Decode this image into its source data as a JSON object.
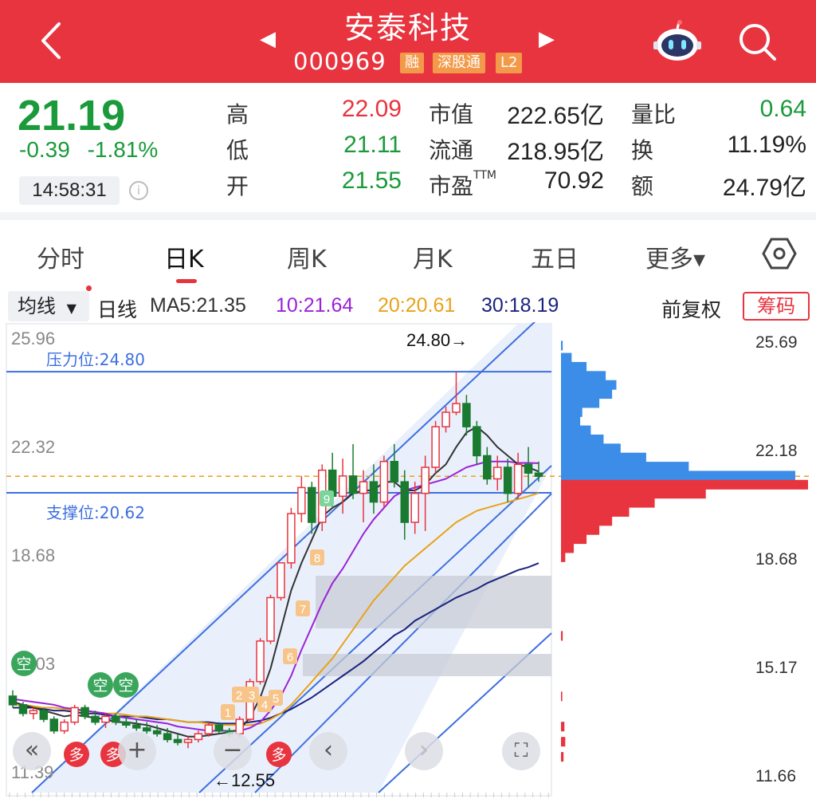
{
  "header": {
    "stock_name": "安泰科技",
    "code": "000969",
    "tags": [
      "融",
      "深股通",
      "L2"
    ],
    "colors": {
      "bar": "#e8343f",
      "tag": "#f39a4a"
    }
  },
  "quote": {
    "price": "21.19",
    "change": "-0.39",
    "change_pct": "-1.81%",
    "time": "14:58:31",
    "high_label": "高",
    "high": "22.09",
    "low_label": "低",
    "low": "21.11",
    "open_label": "开",
    "open": "21.55",
    "mktcap_label": "市值",
    "mktcap": "222.65亿",
    "float_label": "流通",
    "float": "218.95亿",
    "pe_label": "市盈",
    "pe_sup": "TTM",
    "pe": "70.92",
    "volratio_label": "量比",
    "volratio": "0.64",
    "turnover_label": "换",
    "turnover": "11.19%",
    "amount_label": "额",
    "amount": "24.79亿",
    "colors": {
      "down": "#1a9a3a",
      "up": "#e8343f"
    }
  },
  "tabs": [
    {
      "label": "分时"
    },
    {
      "label": "日K",
      "active": true
    },
    {
      "label": "周K"
    },
    {
      "label": "月K"
    },
    {
      "label": "五日"
    },
    {
      "label": "更多▾"
    }
  ],
  "ma_bar": {
    "selector": "均线",
    "line_type": "日线",
    "ma5": "MA5:21.35",
    "ma10": "10:21.64",
    "ma20": "20:20.61",
    "ma30": "30:18.19",
    "adjust": "前复权",
    "chips": "筹码",
    "colors": {
      "ma5": "#333333",
      "ma10": "#9b22d6",
      "ma20": "#e8a21a",
      "ma30": "#1a237e"
    }
  },
  "chart": {
    "y_labels": [
      "25.96",
      "22.32",
      "18.68",
      "15.03",
      "11.39"
    ],
    "pressure_label": "压力位:24.80",
    "support_label": "支撑位:20.62",
    "peak_label": "24.80→",
    "low_label": "←12.55",
    "chip_labels": [
      "25.69",
      "22.18",
      "18.68",
      "15.17",
      "11.66"
    ],
    "signals_kong": [
      "空",
      "空",
      "空"
    ],
    "signals_duo": [
      "多",
      "多",
      "多"
    ],
    "counts": [
      "1",
      "2",
      "3",
      "4",
      "5",
      "6",
      "7",
      "8",
      "9"
    ],
    "controls": {
      "back": "«",
      "zoom_in": "+",
      "zoom_out": "−",
      "prev": "‹",
      "next": "›",
      "fullscreen": "⛶"
    },
    "candles": [
      [
        13.6,
        13.8,
        13.2,
        13.3
      ],
      [
        13.3,
        13.4,
        12.9,
        13.0
      ],
      [
        13.0,
        13.2,
        12.8,
        13.1
      ],
      [
        13.1,
        13.2,
        12.7,
        12.8
      ],
      [
        12.8,
        12.9,
        12.3,
        12.4
      ],
      [
        12.4,
        12.8,
        12.3,
        12.7
      ],
      [
        12.7,
        13.3,
        12.6,
        13.2
      ],
      [
        13.2,
        13.3,
        12.8,
        12.9
      ],
      [
        12.9,
        13.1,
        12.6,
        12.7
      ],
      [
        12.7,
        13.0,
        12.5,
        12.9
      ],
      [
        12.9,
        13.0,
        12.6,
        12.7
      ],
      [
        12.7,
        12.9,
        12.5,
        12.6
      ],
      [
        12.6,
        12.8,
        12.4,
        12.5
      ],
      [
        12.5,
        12.7,
        12.3,
        12.4
      ],
      [
        12.4,
        12.6,
        12.2,
        12.3
      ],
      [
        12.3,
        12.5,
        12.0,
        12.1
      ],
      [
        12.1,
        12.3,
        11.9,
        12.0
      ],
      [
        12.0,
        12.2,
        11.8,
        12.1
      ],
      [
        12.1,
        12.4,
        12.0,
        12.3
      ],
      [
        12.3,
        12.7,
        12.2,
        12.6
      ],
      [
        12.6,
        12.7,
        12.3,
        12.4
      ],
      [
        12.4,
        12.5,
        12.2,
        12.3
      ],
      [
        12.3,
        12.9,
        12.2,
        12.8
      ],
      [
        12.8,
        14.2,
        12.7,
        14.1
      ],
      [
        14.1,
        15.6,
        14.0,
        15.5
      ],
      [
        15.5,
        17.1,
        15.4,
        17.0
      ],
      [
        17.0,
        18.2,
        16.9,
        18.2
      ],
      [
        18.2,
        20.1,
        18.0,
        19.9
      ],
      [
        19.9,
        21.2,
        19.6,
        20.8
      ],
      [
        20.8,
        21.0,
        19.2,
        19.6
      ],
      [
        19.6,
        21.6,
        19.3,
        21.4
      ],
      [
        21.4,
        22.0,
        20.1,
        20.5
      ],
      [
        20.5,
        21.8,
        19.9,
        21.2
      ],
      [
        21.2,
        22.3,
        20.4,
        20.6
      ],
      [
        20.6,
        21.4,
        19.6,
        21.0
      ],
      [
        21.0,
        21.6,
        19.9,
        20.3
      ],
      [
        20.3,
        21.9,
        20.1,
        21.7
      ],
      [
        21.7,
        22.3,
        20.8,
        21.0
      ],
      [
        21.0,
        21.4,
        19.0,
        19.6
      ],
      [
        19.6,
        21.0,
        19.2,
        20.6
      ],
      [
        20.6,
        21.9,
        19.3,
        21.5
      ],
      [
        21.5,
        23.1,
        21.3,
        22.9
      ],
      [
        22.9,
        23.6,
        22.7,
        23.4
      ],
      [
        23.4,
        24.8,
        23.3,
        23.7
      ],
      [
        23.7,
        24.0,
        22.6,
        22.9
      ],
      [
        22.9,
        23.1,
        21.6,
        21.9
      ],
      [
        21.9,
        22.2,
        20.9,
        21.1
      ],
      [
        21.1,
        21.9,
        20.7,
        21.5
      ],
      [
        21.5,
        21.8,
        20.3,
        20.6
      ],
      [
        20.6,
        22.0,
        20.4,
        21.6
      ],
      [
        21.6,
        22.2,
        20.8,
        21.3
      ],
      [
        21.3,
        21.7,
        21.0,
        21.19
      ]
    ],
    "ma5": [
      13.4,
      13.3,
      13.2,
      13.1,
      13.0,
      12.9,
      12.95,
      12.9,
      12.85,
      12.8,
      12.7,
      12.7,
      12.65,
      12.6,
      12.5,
      12.4,
      12.3,
      12.2,
      12.2,
      12.25,
      12.3,
      12.35,
      12.45,
      12.85,
      13.55,
      14.55,
      15.9,
      17.25,
      18.2,
      19.0,
      19.8,
      20.1,
      20.3,
      20.6,
      20.7,
      20.7,
      21.0,
      21.0,
      20.7,
      20.7,
      20.9,
      21.3,
      21.6,
      22.2,
      22.7,
      22.9,
      22.6,
      22.2,
      21.9,
      21.6,
      21.5,
      21.35
    ],
    "ma10": [
      13.5,
      13.45,
      13.4,
      13.35,
      13.3,
      13.2,
      13.15,
      13.1,
      13.05,
      13.0,
      12.9,
      12.85,
      12.8,
      12.75,
      12.7,
      12.65,
      12.55,
      12.5,
      12.45,
      12.4,
      12.4,
      12.4,
      12.4,
      12.5,
      12.7,
      13.1,
      13.6,
      14.3,
      15.2,
      16.0,
      16.8,
      17.5,
      18.0,
      18.6,
      19.2,
      19.7,
      20.1,
      20.5,
      20.7,
      20.8,
      20.9,
      21.0,
      21.1,
      21.3,
      21.5,
      21.6,
      21.7,
      21.7,
      21.7,
      21.65,
      21.65,
      21.64
    ],
    "ma20": [
      13.3,
      13.3,
      13.25,
      13.2,
      13.2,
      13.15,
      13.1,
      13.1,
      13.05,
      13.0,
      13.0,
      12.95,
      12.9,
      12.9,
      12.85,
      12.8,
      12.75,
      12.7,
      12.7,
      12.65,
      12.6,
      12.6,
      12.6,
      12.6,
      12.65,
      12.8,
      13.0,
      13.3,
      13.7,
      14.1,
      14.5,
      14.9,
      15.4,
      15.9,
      16.4,
      16.9,
      17.3,
      17.7,
      18.1,
      18.4,
      18.7,
      19.0,
      19.3,
      19.6,
      19.8,
      20.0,
      20.1,
      20.2,
      20.3,
      20.4,
      20.5,
      20.61
    ],
    "ma30": [
      13.2,
      13.2,
      13.2,
      13.15,
      13.1,
      13.1,
      13.05,
      13.0,
      13.0,
      12.95,
      12.9,
      12.9,
      12.9,
      12.85,
      12.8,
      12.8,
      12.75,
      12.7,
      12.7,
      12.7,
      12.65,
      12.65,
      12.65,
      12.7,
      12.75,
      12.85,
      13.0,
      13.15,
      13.35,
      13.55,
      13.8,
      14.05,
      14.3,
      14.55,
      14.8,
      15.1,
      15.4,
      15.7,
      15.9,
      16.2,
      16.4,
      16.6,
      16.8,
      17.0,
      17.15,
      17.3,
      17.5,
      17.65,
      17.8,
      17.95,
      18.05,
      18.19
    ],
    "chip_profile": [
      [
        25.6,
        0.4
      ],
      [
        25.2,
        2.5
      ],
      [
        24.9,
        6.0
      ],
      [
        24.6,
        10.5
      ],
      [
        24.3,
        13.0
      ],
      [
        24.0,
        12.0
      ],
      [
        23.7,
        9.0
      ],
      [
        23.4,
        5.0
      ],
      [
        23.1,
        4.5
      ],
      [
        22.8,
        7.0
      ],
      [
        22.5,
        10.0
      ],
      [
        22.2,
        14.0
      ],
      [
        21.9,
        20.0
      ],
      [
        21.6,
        30.0
      ],
      [
        21.3,
        55.0
      ],
      [
        21.0,
        58.0
      ],
      [
        20.7,
        34.0
      ],
      [
        20.4,
        22.0
      ],
      [
        20.1,
        16.0
      ],
      [
        19.8,
        12.0
      ],
      [
        19.5,
        9.0
      ],
      [
        19.2,
        6.0
      ],
      [
        18.9,
        3.0
      ],
      [
        18.6,
        1.0
      ],
      [
        16.0,
        0.4
      ],
      [
        14.0,
        0.3
      ],
      [
        13.0,
        0.8
      ],
      [
        12.5,
        1.0
      ],
      [
        12.0,
        0.6
      ]
    ]
  }
}
